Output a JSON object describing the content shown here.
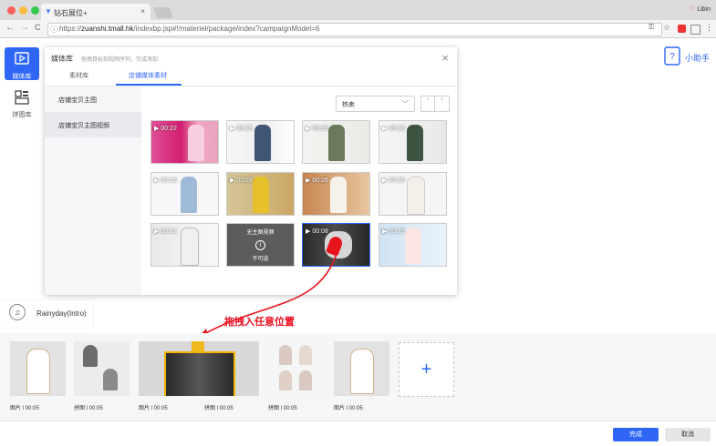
{
  "browser": {
    "tab_title": "钻石展位+",
    "tab_close": "×",
    "url_prefix": "https://",
    "url_host": "zuanshi.tmall.hk",
    "url_path": "/indexbp.jsp#!/materiel/package/index?campaignModel=6",
    "user_name": "Libin",
    "nav_back": "←",
    "nav_forward": "→",
    "nav_reload": "C",
    "menu": "⋮",
    "star": "☆",
    "key": "🔑"
  },
  "leftnav": {
    "media_library": "媒体库",
    "collage_library": "拼图库"
  },
  "helper_label": "小助手",
  "modal": {
    "title": "媒体库",
    "hint": "拖拽目标到视频序列，完成添加",
    "close": "×",
    "tabs": [
      "素材库",
      "店铺媒体素材"
    ],
    "side_items": [
      "店铺宝贝主图",
      "店铺宝贝主图视频"
    ],
    "sort_value": "热卖",
    "sort_chevron": "﹀",
    "page_prev": "‹",
    "page_next": "›",
    "grid": [
      {
        "duration": "▶ 00:22"
      },
      {
        "duration": "▶ 00:25"
      },
      {
        "duration": "▶ 00:26"
      },
      {
        "duration": "▶ 00:18"
      },
      {
        "duration": "▶ 00:15"
      },
      {
        "duration": "▶ 00:28"
      },
      {
        "duration": "▶ 00:26"
      },
      {
        "duration": "▶ 00:25"
      },
      {
        "duration": "▶ 00:21"
      },
      {
        "duration": "无主图视频",
        "unavailable": "不可选"
      },
      {
        "duration": "▶ 00:08"
      },
      {
        "duration": "▶ 00:25"
      }
    ]
  },
  "music": {
    "name": "Rainyday(Intro)",
    "icon": "♫"
  },
  "drag_tip": "拖拽入任意位置",
  "timeline": {
    "cards": [
      {
        "label": "图片 l 00:05"
      },
      {
        "label": "拼图 l 00:05"
      },
      {
        "label": "图片 l 00:05"
      },
      {
        "label": "拼图 l 00:05"
      },
      {
        "label": "拼图 l 00:05"
      },
      {
        "label": "图片 l 00:05"
      }
    ],
    "add": "+"
  },
  "footer": {
    "confirm": "完成",
    "cancel": "取消"
  },
  "colors": {
    "accent": "#2f66f6",
    "drag_arrow": "#e8141b",
    "drop_highlight": "#f4b400"
  }
}
